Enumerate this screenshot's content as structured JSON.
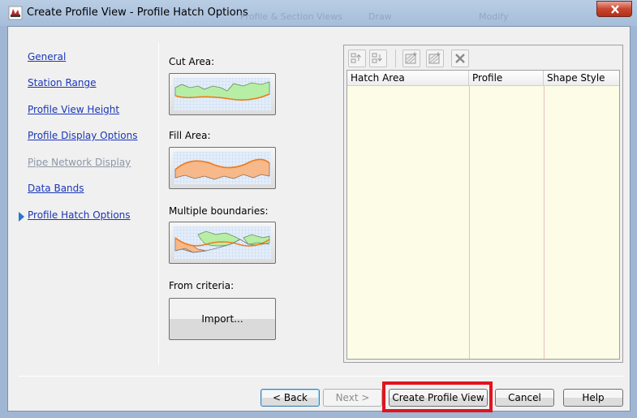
{
  "window": {
    "title": "Create Profile View - Profile Hatch Options",
    "background_menu": [
      "Profile & Section Views",
      "Draw",
      "Modify"
    ]
  },
  "nav": {
    "items": [
      {
        "label": "General",
        "disabled": false
      },
      {
        "label": "Station Range",
        "disabled": false
      },
      {
        "label": "Profile View Height",
        "disabled": false
      },
      {
        "label": "Profile Display Options",
        "disabled": false
      },
      {
        "label": "Pipe Network Display",
        "disabled": true
      },
      {
        "label": "Data Bands",
        "disabled": false
      },
      {
        "label": "Profile Hatch Options",
        "disabled": false,
        "current": true
      }
    ]
  },
  "options": {
    "cut_area_label": "Cut Area:",
    "fill_area_label": "Fill Area:",
    "multiple_boundaries_label": "Multiple boundaries:",
    "from_criteria_label": "From criteria:",
    "import_label": "Import..."
  },
  "table": {
    "columns": [
      "Hatch Area",
      "Profile",
      "Shape Style"
    ],
    "rows": []
  },
  "buttons": {
    "back": "< Back",
    "next": "Next >",
    "create": "Create Profile View",
    "cancel": "Cancel",
    "help": "Help"
  },
  "colors": {
    "link": "#1a36b8",
    "highlight": "#e0141e",
    "grid_bg": "#fdfce6",
    "cut_fill": "#b6eea6",
    "fill_fill": "#f7b98a",
    "profile_line": "#f07a18"
  }
}
